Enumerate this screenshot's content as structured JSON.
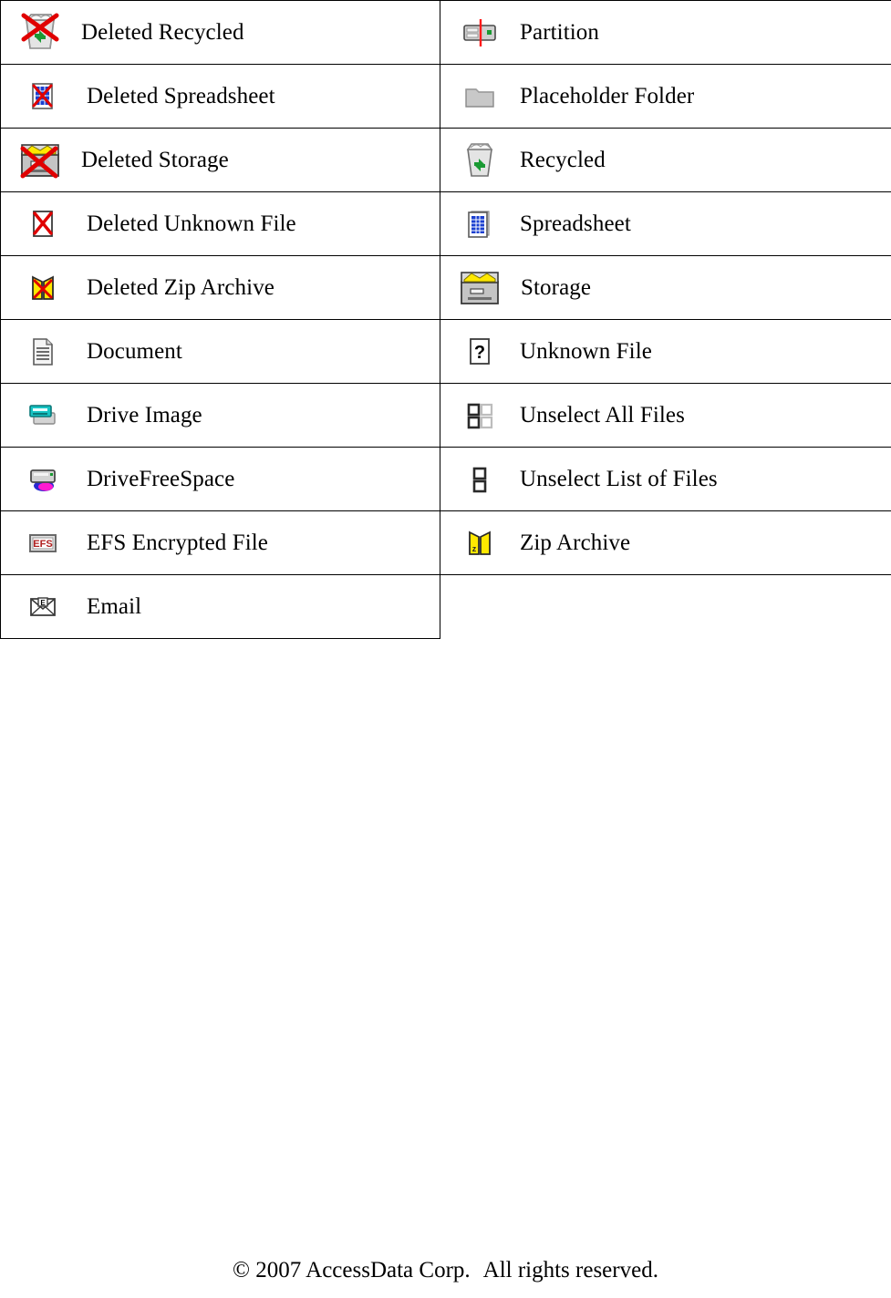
{
  "document": {
    "title": "AccessData FTK Icon Legend",
    "columns": 2
  },
  "table": {
    "left_column": [
      {
        "icon": "deleted-recycled-icon",
        "label": "Deleted Recycled"
      },
      {
        "icon": "deleted-spreadsheet-icon",
        "label": "Deleted Spreadsheet"
      },
      {
        "icon": "deleted-storage-icon",
        "label": "Deleted Storage"
      },
      {
        "icon": "deleted-unknown-file-icon",
        "label": "Deleted Unknown File"
      },
      {
        "icon": "deleted-zip-archive-icon",
        "label": "Deleted Zip Archive"
      },
      {
        "icon": "document-icon",
        "label": "Document"
      },
      {
        "icon": "drive-image-icon",
        "label": "Drive Image"
      },
      {
        "icon": "drive-free-space-icon",
        "label": "DriveFreeSpace"
      },
      {
        "icon": "efs-encrypted-file-icon",
        "label": "EFS Encrypted File"
      },
      {
        "icon": "email-icon",
        "label": "Email"
      }
    ],
    "right_column": [
      {
        "icon": "partition-icon",
        "label": "Partition"
      },
      {
        "icon": "placeholder-folder-icon",
        "label": "Placeholder Folder"
      },
      {
        "icon": "recycled-icon",
        "label": "Recycled"
      },
      {
        "icon": "spreadsheet-icon",
        "label": "Spreadsheet"
      },
      {
        "icon": "storage-icon",
        "label": "Storage"
      },
      {
        "icon": "unknown-file-icon",
        "label": "Unknown File"
      },
      {
        "icon": "unselect-all-files-icon",
        "label": "Unselect All Files"
      },
      {
        "icon": "unselect-list-of-files-icon",
        "label": "Unselect List of Files"
      },
      {
        "icon": "zip-archive-icon",
        "label": "Zip Archive"
      }
    ]
  },
  "footer": {
    "copyright": "© 2007 AccessData Corp.",
    "rights": "All rights reserved."
  },
  "colors": {
    "border": "#000000",
    "text": "#000000",
    "background": "#ffffff",
    "delete_mark": "#e00000",
    "recycle_green": "#1a9a33",
    "icon_grey_light": "#d8d8d8",
    "icon_grey_mid": "#a8a8a8",
    "icon_grey_dark": "#6e6e6e",
    "spreadsheet_blue": "#1a3fd0",
    "zip_yellow": "#ffe800",
    "drive_cyan": "#17c4c4",
    "free_space_magenta": "#ff1ad0",
    "free_space_blue": "#2a2ad0",
    "efs_red": "#b02020",
    "partition_red": "#ff1a1a"
  }
}
